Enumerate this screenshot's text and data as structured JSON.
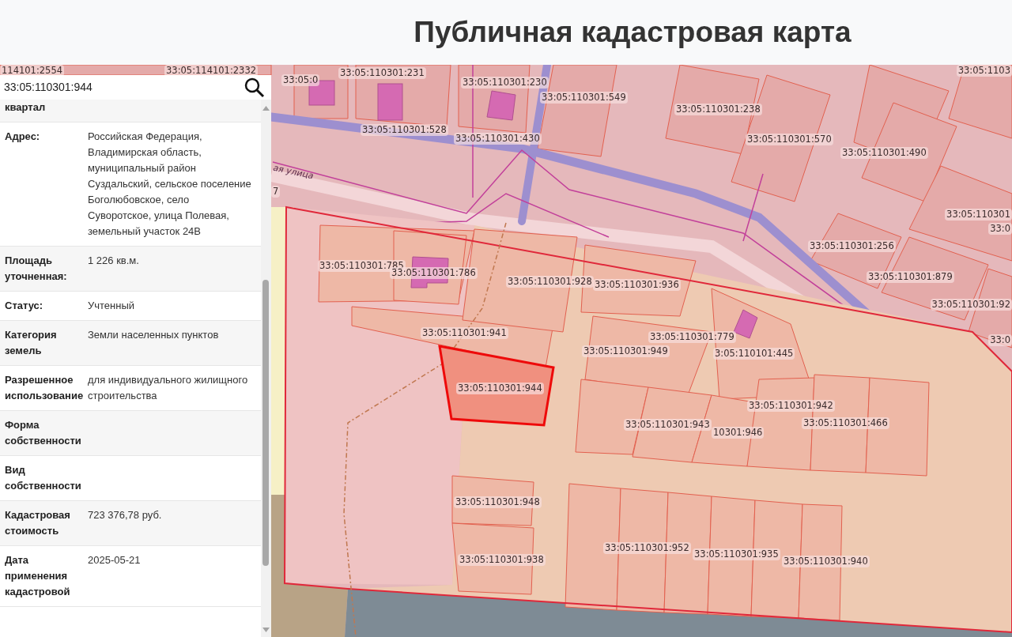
{
  "header": {
    "title": "Публичная кадастровая карта"
  },
  "search": {
    "value": "33:05:110301:944"
  },
  "details": [
    {
      "label": "квартал"
    },
    {
      "label": "Адрес:",
      "value": "Российская Федерация, Владимирская область, муниципальный район Суздальский, сельское поселение Боголюбовское, село Суворотское, улица Полевая, земельный участок 24В"
    },
    {
      "label": "Площадь уточненная:",
      "value": "1 226 кв.м."
    },
    {
      "label": "Статус:",
      "value": "Учтенный"
    },
    {
      "label": "Категория земель",
      "value": "Земли населенных пунктов"
    },
    {
      "label": "Разрешенное использование",
      "value": "для индивидуального жилищного строительства"
    },
    {
      "label": "Форма собственности"
    },
    {
      "label": "Вид собственности"
    },
    {
      "label": "Кадастровая стоимость",
      "value": "723 376,78 руб."
    },
    {
      "label": "Дата применения кадастровой",
      "value": "2025-05-21"
    }
  ],
  "map": {
    "street_label": "ая улица",
    "labels": [
      "114101:2554",
      "33:05:114101:2332",
      "33:05:0",
      "33:05:110301:231",
      "33:05:110301:230",
      "33:05:110301:549",
      "33:05:110301:238",
      "33:05:110301:528",
      "33:05:110301:430",
      "33:05:110301:570",
      "33:05:110301:490",
      "33:05:1103",
      "7",
      "33:05:110301",
      "33:0",
      "33:05:110301:256",
      "33:05:110301:879",
      "33:05:110301:92",
      "33:0",
      "33:05:110301:785",
      "33:05:110301:786",
      "33:05:110301:928",
      "33:05:110301:936",
      "33:05:110301:941",
      "33:05:110301:779",
      "33:05:110301:949",
      "3:05:110101:445",
      "33:05:110301:944",
      "33:05:110301:942",
      "33:05:110301:943",
      "10301:946",
      "33:05:110301:466",
      "33:05:110301:948",
      "33:05:110301:938",
      "33:05:110301:952",
      "33:05:110301:935",
      "33:05:110301:940"
    ]
  }
}
